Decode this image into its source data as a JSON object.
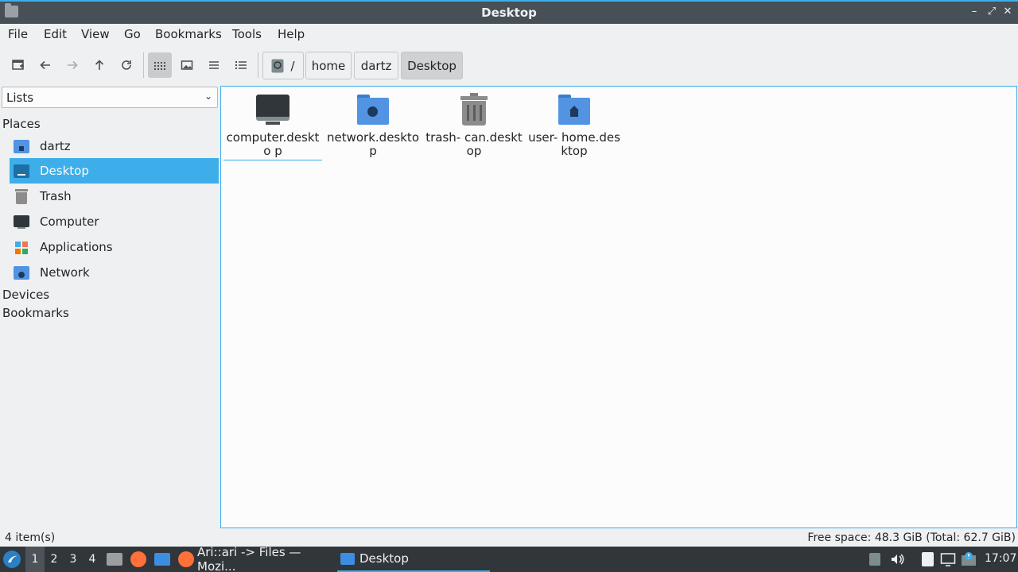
{
  "window": {
    "title": "Desktop"
  },
  "menubar": {
    "items": [
      "File",
      "Edit",
      "View",
      "Go",
      "Bookmarks",
      "Tools",
      "Help"
    ]
  },
  "toolbar": {
    "buttons": [
      "new-tab-icon",
      "back-icon",
      "forward-icon",
      "up-icon",
      "reload-icon",
      "icon-view-icon",
      "thumbnail-view-icon",
      "compact-view-icon",
      "detailed-list-icon"
    ],
    "breadcrumb": [
      "/",
      "home",
      "dartz",
      "Desktop"
    ]
  },
  "side": {
    "mode": "Lists",
    "places_heading": "Places",
    "places": [
      {
        "label": "dartz",
        "icon": "home-folder-icon"
      },
      {
        "label": "Desktop",
        "icon": "desktop-icon",
        "selected": true
      },
      {
        "label": "Trash",
        "icon": "trash-icon"
      },
      {
        "label": "Computer",
        "icon": "computer-icon"
      },
      {
        "label": "Applications",
        "icon": "applications-icon"
      },
      {
        "label": "Network",
        "icon": "network-icon"
      }
    ],
    "devices_heading": "Devices",
    "bookmarks_heading": "Bookmarks"
  },
  "files": [
    {
      "name": "computer.deskto p",
      "icon": "computer-icon"
    },
    {
      "name": "network.desktop",
      "icon": "network-folder-icon"
    },
    {
      "name": "trash- can.desktop",
      "icon": "trash-icon"
    },
    {
      "name": "user- home.desktop",
      "icon": "home-folder-icon"
    }
  ],
  "status": {
    "count": "4 item(s)",
    "free_space": "Free space: 48.3 GiB (Total: 62.7 GiB)"
  },
  "taskbar": {
    "workspaces": [
      "1",
      "2",
      "3",
      "4"
    ],
    "tasks": [
      {
        "label": "Ari::ari -> Files — Mozi...",
        "icon": "firefox-icon"
      },
      {
        "label": "Desktop",
        "icon": "folder-icon"
      }
    ],
    "clock": "17:07"
  },
  "colors": {
    "accent": "#3daee9",
    "titlebar": "#475057",
    "taskbar": "#31363b",
    "folder": "#5294e2"
  }
}
